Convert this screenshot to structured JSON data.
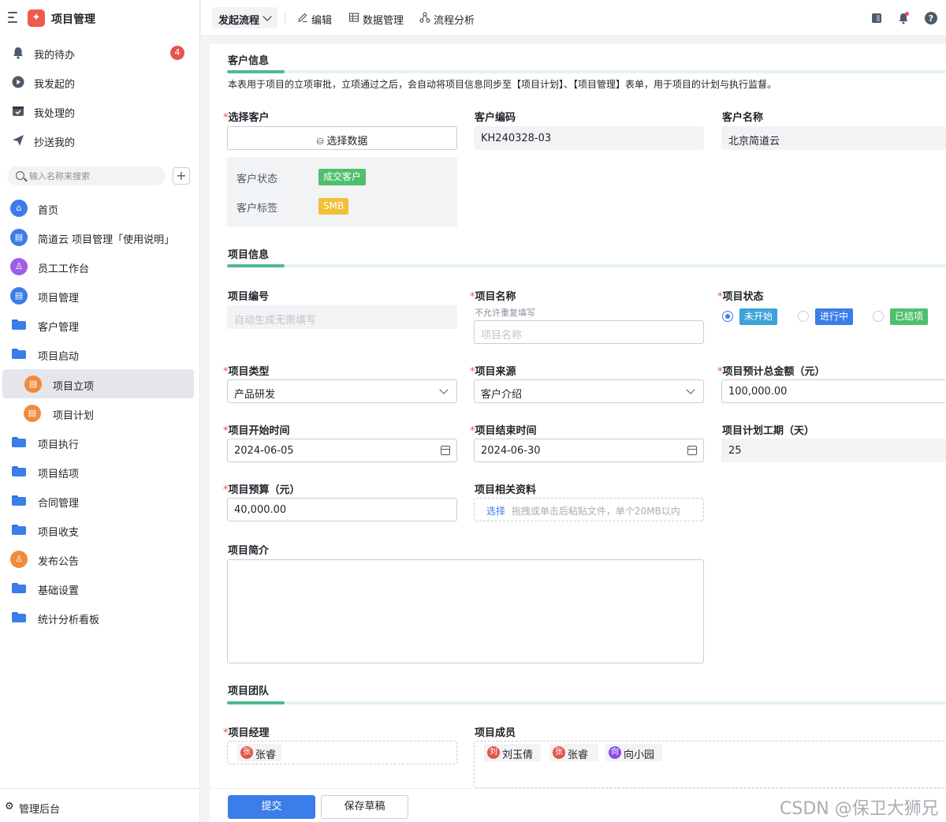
{
  "app": {
    "title": "项目管理",
    "logo_icon": "puzzle-icon",
    "brand_color": "#ef5a4c"
  },
  "quick_nav": [
    {
      "label": "我的待办",
      "icon": "bell-icon",
      "badge": "4"
    },
    {
      "label": "我发起的",
      "icon": "play-circle-icon"
    },
    {
      "label": "我处理的",
      "icon": "inbox-check-icon"
    },
    {
      "label": "抄送我的",
      "icon": "send-icon"
    }
  ],
  "search": {
    "placeholder": "输入名称来搜索",
    "add_label": "+"
  },
  "nav": [
    {
      "label": "首页",
      "icon": "home-icon",
      "color": "#3b7de9"
    },
    {
      "label": "简道云 项目管理「使用说明」",
      "icon": "document-icon",
      "color": "#3b7de9"
    },
    {
      "label": "员工工作台",
      "icon": "person-icon",
      "color": "#a05de6"
    },
    {
      "label": "项目管理",
      "icon": "document-icon",
      "color": "#3b7de9"
    },
    {
      "label": "客户管理",
      "icon": "folder-icon",
      "color": "#3b7de9"
    },
    {
      "label": "项目启动",
      "icon": "folder-open-icon",
      "color": "#3b7de9"
    },
    {
      "label": "项目立项",
      "icon": "document-icon",
      "color": "#f08a3c"
    },
    {
      "label": "项目计划",
      "icon": "document-icon",
      "color": "#f08a3c"
    },
    {
      "label": "项目执行",
      "icon": "folder-icon",
      "color": "#3b7de9"
    },
    {
      "label": "项目结项",
      "icon": "folder-icon",
      "color": "#3b7de9"
    },
    {
      "label": "合同管理",
      "icon": "folder-icon",
      "color": "#3b7de9"
    },
    {
      "label": "项目收支",
      "icon": "folder-icon",
      "color": "#3b7de9"
    },
    {
      "label": "发布公告",
      "icon": "person-icon",
      "color": "#f08a3c"
    },
    {
      "label": "基础设置",
      "icon": "folder-icon",
      "color": "#3b7de9"
    },
    {
      "label": "统计分析看板",
      "icon": "folder-icon",
      "color": "#3b7de9"
    }
  ],
  "footer": {
    "label": "管理后台",
    "icon": "gear-icon"
  },
  "toolbar": {
    "flow_label": "发起流程",
    "edit_label": "编辑",
    "data_label": "数据管理",
    "analysis_label": "流程分析"
  },
  "form": {
    "customer_section": {
      "title": "客户信息",
      "description": "本表用于项目的立项审批，立项通过之后，会自动将项目信息同步至【项目计划】、【项目管理】表单，用于项目的计划与执行监督。",
      "select_customer_label": "选择客户",
      "select_data_button": "选择数据",
      "customer_code_label": "客户编码",
      "customer_code_value": "KH240328-03",
      "customer_name_label": "客户名称",
      "customer_name_value": "北京简道云",
      "status_label": "客户状态",
      "status_value": "成交客户",
      "tag_label": "客户标签",
      "tag_value": "SMB"
    },
    "project_section": {
      "title": "项目信息",
      "number_label": "项目编号",
      "number_placeholder": "自动生成无需填写",
      "name_label": "项目名称",
      "name_hint": "不允许重复填写",
      "name_placeholder": "项目名称",
      "state_label": "项目状态",
      "state_options": [
        "未开始",
        "进行中",
        "已结项"
      ],
      "state_selected": "未开始",
      "type_label": "项目类型",
      "type_value": "产品研发",
      "source_label": "项目来源",
      "source_value": "客户介绍",
      "total_label": "项目预计总金额（元）",
      "total_value": "100,000.00",
      "start_label": "项目开始时间",
      "start_value": "2024-06-05",
      "end_label": "项目结束时间",
      "end_value": "2024-06-30",
      "duration_label": "项目计划工期（天）",
      "duration_value": "25",
      "budget_label": "项目预算（元）",
      "budget_value": "40,000.00",
      "files_label": "项目相关资料",
      "files_select": "选择",
      "files_hint": "拖拽或单击后粘贴文件，单个20MB以内",
      "intro_label": "项目简介"
    },
    "team_section": {
      "title": "项目团队",
      "manager_label": "项目经理",
      "manager": {
        "avatar": "张",
        "name": "张睿"
      },
      "members_label": "项目成员",
      "members": [
        {
          "avatar": "刘",
          "name": "刘玉倩"
        },
        {
          "avatar": "张",
          "name": "张睿"
        },
        {
          "avatar": "向",
          "name": "向小园"
        }
      ]
    },
    "submit_label": "提交",
    "draft_label": "保存草稿"
  },
  "watermark": "CSDN @保卫大狮兄"
}
